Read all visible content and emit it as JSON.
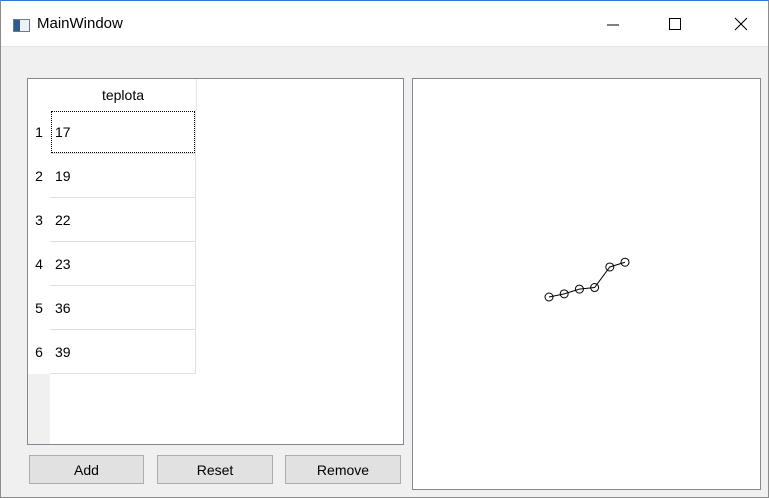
{
  "window": {
    "title": "MainWindow",
    "icons": {
      "app": "app-window-icon",
      "minimize": "minimize-icon",
      "maximize": "maximize-icon",
      "close": "close-icon"
    }
  },
  "table": {
    "column_header": "teplota",
    "rows": [
      {
        "num": "1",
        "value": "17"
      },
      {
        "num": "2",
        "value": "19"
      },
      {
        "num": "3",
        "value": "22"
      },
      {
        "num": "4",
        "value": "23"
      },
      {
        "num": "5",
        "value": "36"
      },
      {
        "num": "6",
        "value": "39"
      }
    ]
  },
  "buttons": {
    "add": "Add",
    "reset": "Reset",
    "remove": "Remove"
  },
  "chart_data": {
    "type": "line",
    "marker": "open-circle",
    "x": [
      1,
      2,
      3,
      4,
      5,
      6
    ],
    "values": [
      17,
      19,
      22,
      23,
      36,
      39
    ],
    "color": "#000000"
  }
}
